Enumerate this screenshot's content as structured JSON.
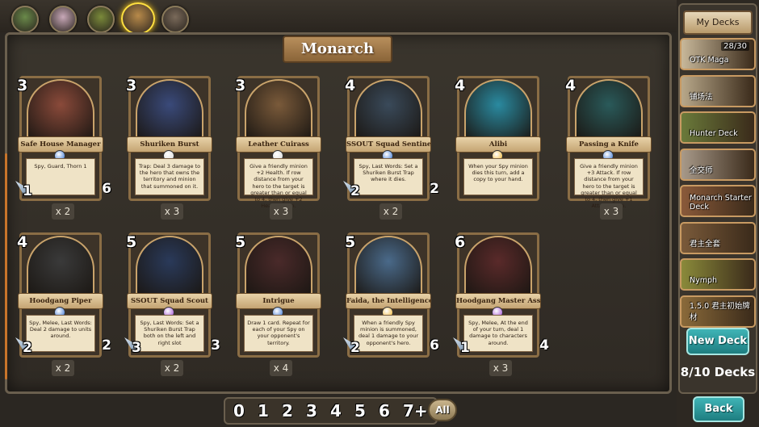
{
  "title": "Monarch",
  "hero_tabs": [
    {
      "name": "hero-tab-1",
      "color": "#6a8a4a"
    },
    {
      "name": "hero-tab-2",
      "color": "#c8a8b8"
    },
    {
      "name": "hero-tab-3",
      "color": "#7a8a3a"
    },
    {
      "name": "hero-tab-4",
      "color": "#b88a4a",
      "selected": true
    },
    {
      "name": "hero-tab-5",
      "color": "#7a6a5a"
    }
  ],
  "cards": [
    {
      "cost": "3",
      "name": "Safe House Manager",
      "text": "Spy, Guard, Thorn 1",
      "attack": "1",
      "health": "6",
      "count": "x 2",
      "gem": "#2a6ad0",
      "art": "#8a4a3a"
    },
    {
      "cost": "3",
      "name": "Shuriken Burst",
      "text": "Trap: Deal 3 damage to the hero that owns the territory and minion that summoned on it.",
      "attack": "",
      "health": "",
      "count": "x 3",
      "gem": "#d8d8d8",
      "art": "#3a4a7a"
    },
    {
      "cost": "3",
      "name": "Leather Cuirass",
      "text": "Give a friendly minion +2 Health. If row distance from your hero to the target is greater than or equal to 4, then give +2 Health again.",
      "attack": "",
      "health": "",
      "count": "x 3",
      "gem": "#d8d8d8",
      "art": "#7a5a3a"
    },
    {
      "cost": "4",
      "name": "SSOUT Squad Sentinel",
      "text": "Spy, Last Words: Set a Shuriken Burst Trap where it dies.",
      "attack": "2",
      "health": "2",
      "count": "x 2",
      "gem": "#2a6ad0",
      "art": "#3a4a5a"
    },
    {
      "cost": "4",
      "name": "Alibi",
      "text": "When your Spy minion dies this turn, add a copy to your hand.",
      "attack": "",
      "health": "",
      "count": "",
      "gem": "#f0b020",
      "art": "#2a8aa0"
    },
    {
      "cost": "4",
      "name": "Passing a Knife",
      "text": "Give a friendly minion +3 Attack. If row distance from your hero to the target is greater than or equal to 4, then give +1 Attack again.",
      "attack": "",
      "health": "",
      "count": "x 3",
      "gem": "#2a6ad0",
      "art": "#2a5a5a"
    },
    {
      "cost": "4",
      "name": "Hoodgang Piper",
      "text": "Spy, Melee, Last Words: Deal 2 damage to units around.",
      "attack": "2",
      "health": "2",
      "count": "x 2",
      "gem": "#2a6ad0",
      "art": "#3a3a3a"
    },
    {
      "cost": "5",
      "name": "SSOUT Squad Scout",
      "text": "Spy, Last Words: Set a Shuriken Burst Trap both on the left and right slot",
      "attack": "3",
      "health": "3",
      "count": "x 2",
      "gem": "#9a40d0",
      "art": "#2a3a5a"
    },
    {
      "cost": "5",
      "name": "Intrigue",
      "text": "Draw 1 card. Repeat for each of your Spy on your opponent's territory.",
      "attack": "",
      "health": "",
      "count": "x 4",
      "gem": "#2a6ad0",
      "art": "#4a2a2a"
    },
    {
      "cost": "5",
      "name": "Faida, the Intelligence First Mate",
      "text": "When a friendly Spy minion is summoned, deal 1 damage to your opponent's hero.",
      "attack": "2",
      "health": "6",
      "count": "",
      "gem": "#f0b020",
      "art": "#4a6a8a"
    },
    {
      "cost": "6",
      "name": "Hoodgang Master Assassin",
      "text": "Spy, Melee, At the end of your turn, deal 1 damage to characters around.",
      "attack": "1",
      "health": "4",
      "count": "x 3",
      "gem": "#9a40d0",
      "art": "#5a2a2a"
    }
  ],
  "sidebar": {
    "header": "My Decks",
    "decks": [
      {
        "name": "OTK Maga",
        "badge": "28/30",
        "color": "#c8b89a"
      },
      {
        "name": "铺场法",
        "badge": "",
        "color": "#b8a88a"
      },
      {
        "name": "Hunter Deck",
        "badge": "",
        "color": "#6a7a3a"
      },
      {
        "name": "全交师",
        "badge": "",
        "color": "#a89a8a"
      },
      {
        "name": "Monarch Starter Deck",
        "badge": "",
        "color": "#8a5a3a"
      },
      {
        "name": "君主全套",
        "badge": "",
        "color": "#7a5a3a"
      },
      {
        "name": "Nymph",
        "badge": "",
        "color": "#8a8a3a"
      },
      {
        "name": "1.5.0 君主初始牌材",
        "badge": "",
        "color": "#8a6a3a"
      }
    ],
    "new_deck": "New Deck",
    "capacity": "8/10 Decks",
    "back": "Back"
  },
  "cost_filters": [
    "0",
    "1",
    "2",
    "3",
    "4",
    "5",
    "6",
    "7+"
  ],
  "filter_all": "All"
}
